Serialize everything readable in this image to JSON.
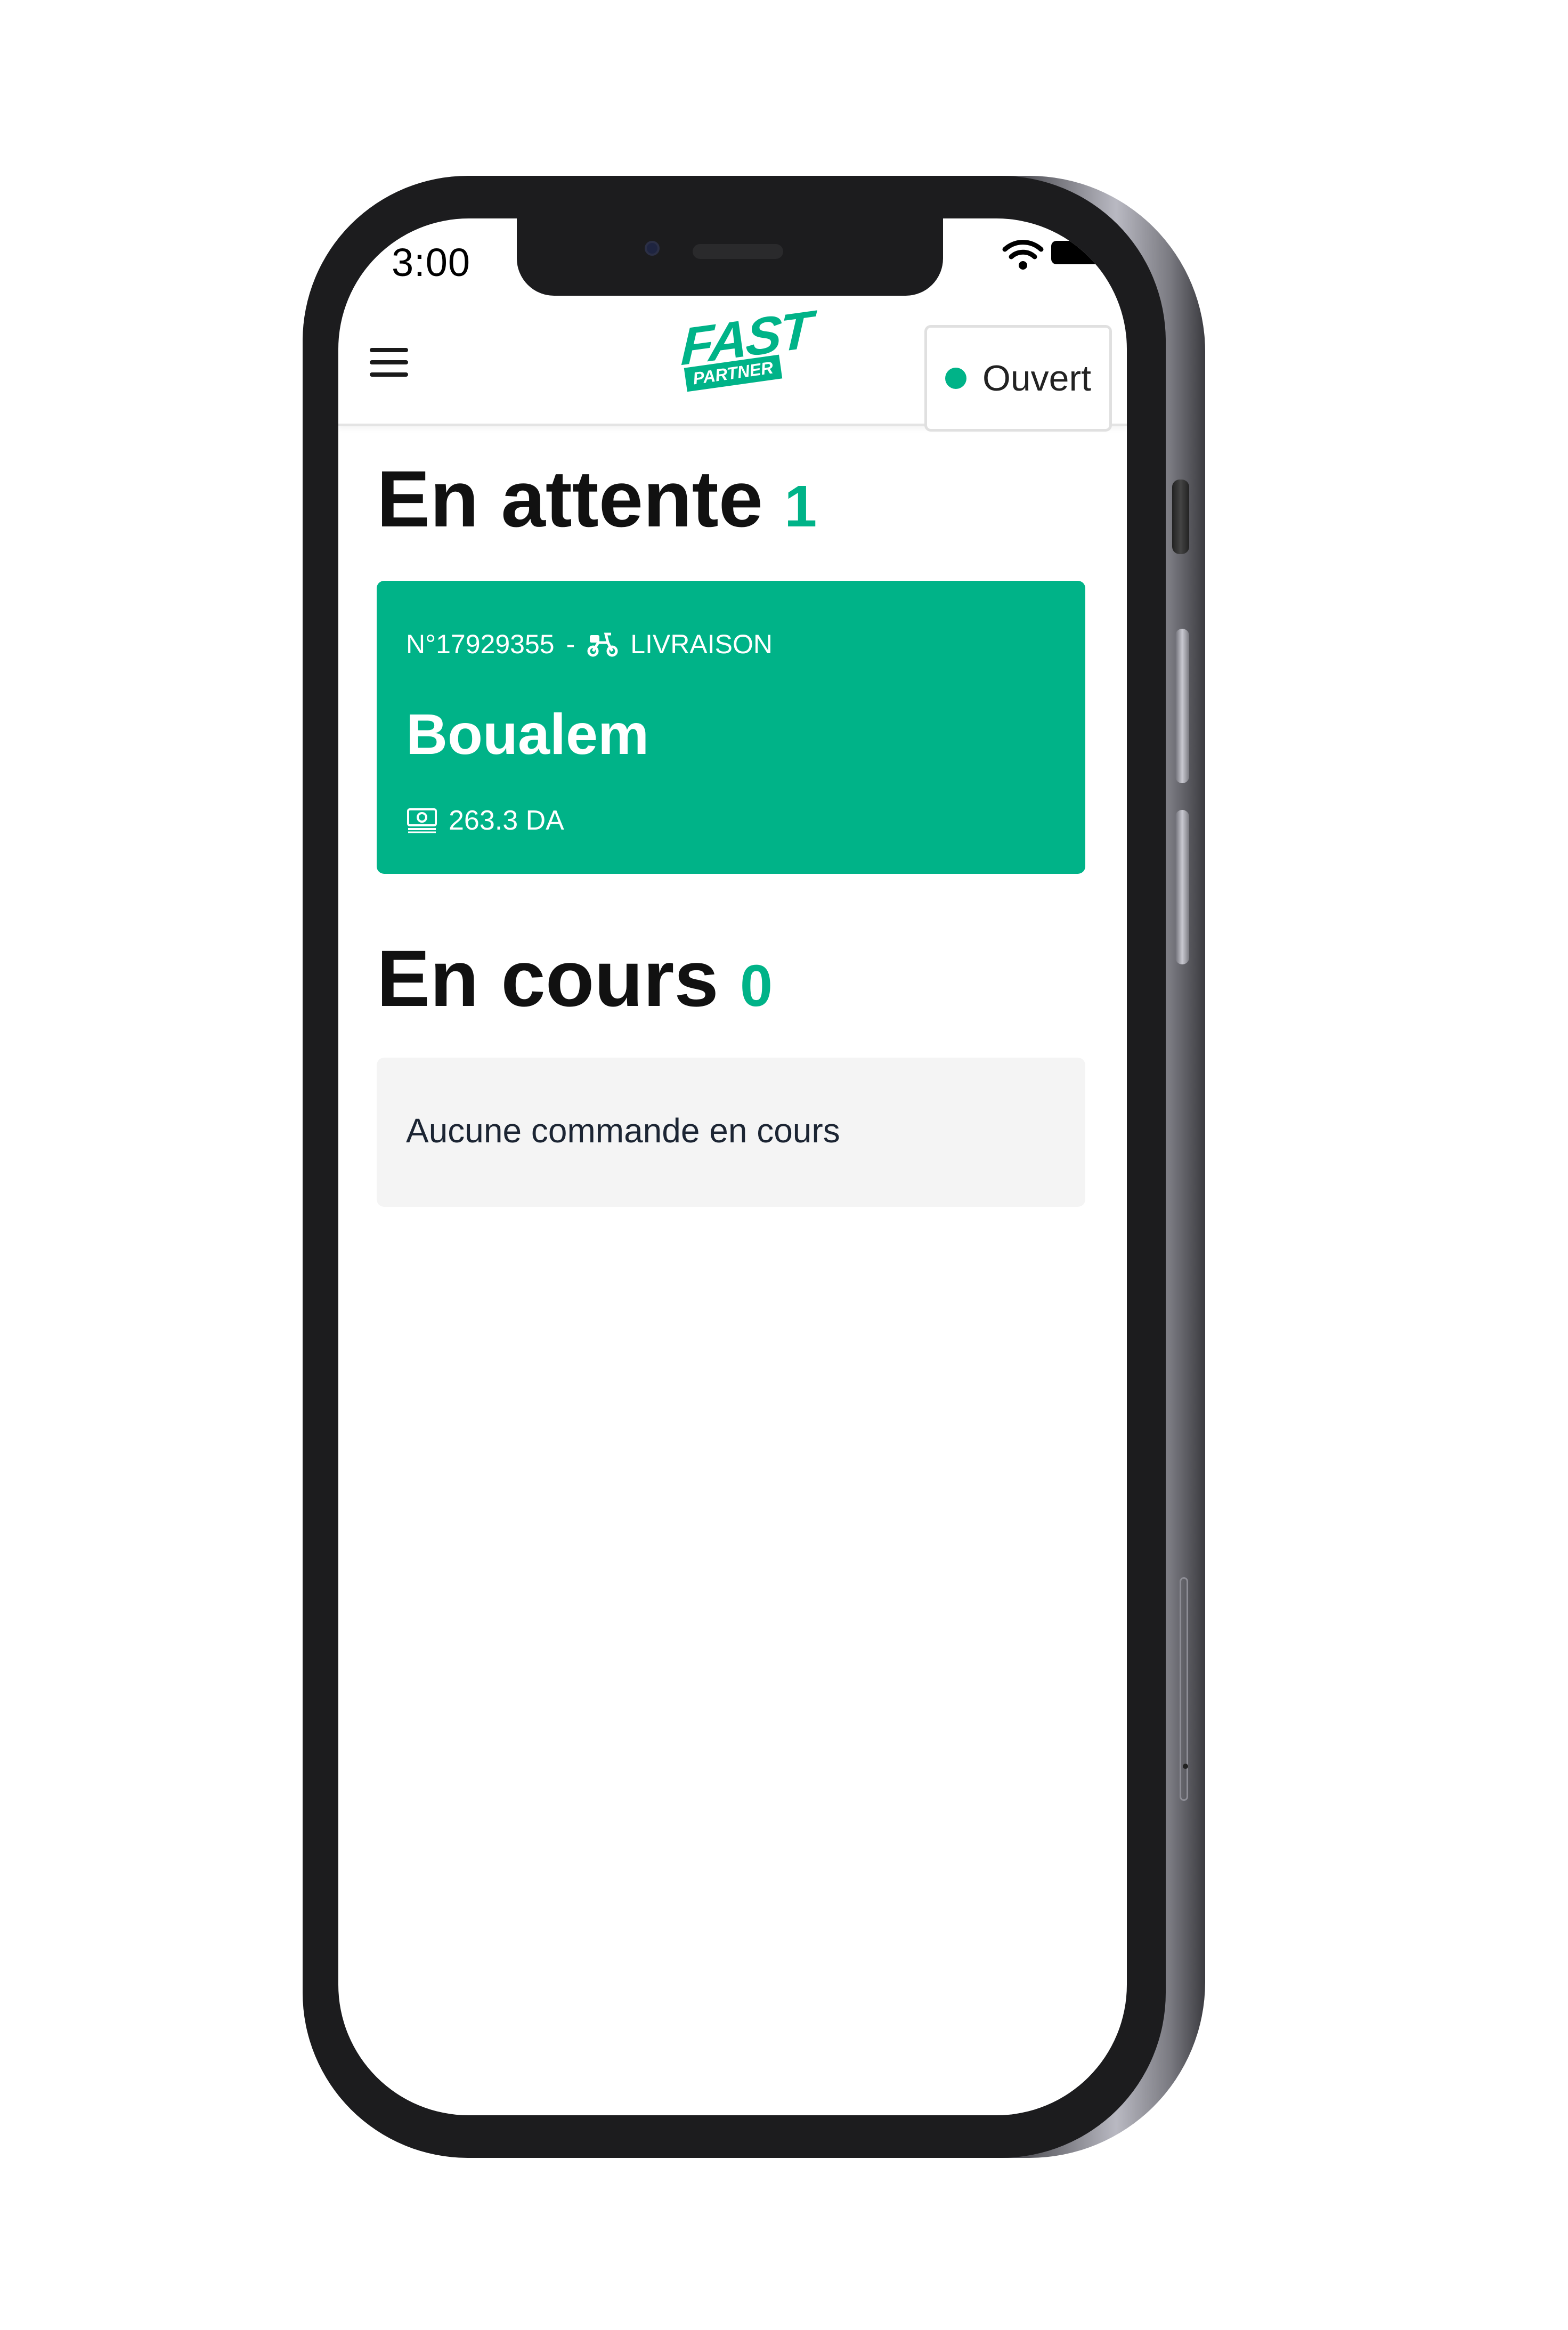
{
  "status_bar": {
    "time": "3:00",
    "wifi_icon": "wifi-icon",
    "battery_icon": "battery-icon"
  },
  "header": {
    "menu_icon": "hamburger-menu-icon",
    "logo": {
      "line1": "FAST",
      "line2": "PARTNER"
    },
    "store_status": {
      "label": "Ouvert",
      "indicator_color": "#00b388"
    }
  },
  "sections": {
    "pending": {
      "title": "En attente",
      "count": "1",
      "orders": [
        {
          "number": "N°17929355",
          "separator": "-",
          "type_icon": "scooter-icon",
          "type": "LIVRAISON",
          "customer": "Boualem",
          "amount_icon": "cash-icon",
          "amount": "263.3 DA"
        }
      ]
    },
    "current": {
      "title": "En cours",
      "count": "0",
      "empty_message": "Aucune commande en cours"
    }
  },
  "colors": {
    "accent": "#00b388",
    "text": "#111111",
    "empty_bg": "#f4f4f4"
  }
}
